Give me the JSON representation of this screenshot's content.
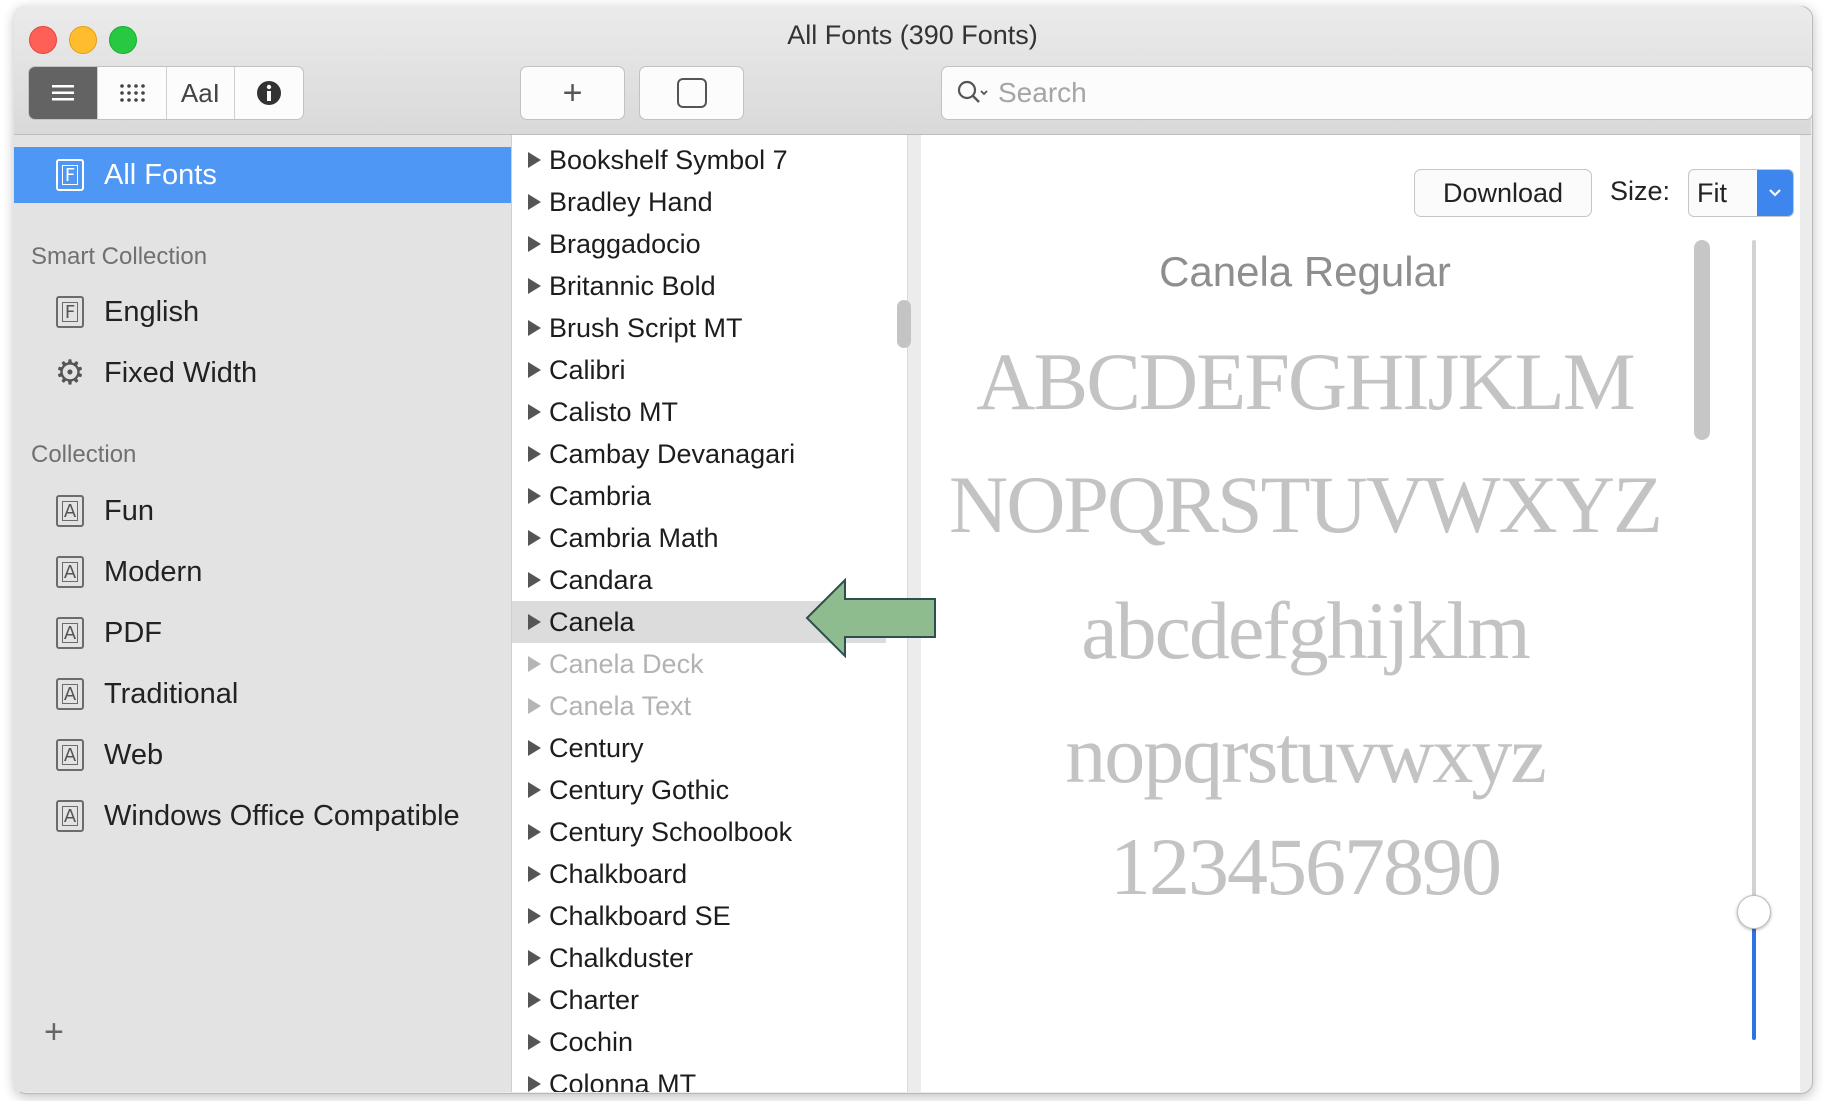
{
  "window": {
    "title": "All Fonts (390 Fonts)"
  },
  "toolbar": {
    "view_modes": [
      {
        "name": "list-view",
        "glyph": "≡"
      },
      {
        "name": "grid-view",
        "glyph": "⠿"
      },
      {
        "name": "sample-view",
        "glyph": "AaI"
      },
      {
        "name": "info-view",
        "glyph": "i"
      }
    ],
    "add_glyph": "+",
    "search_placeholder": "Search"
  },
  "sidebar": {
    "all_fonts": "All Fonts",
    "smart_collection_header": "Smart Collection",
    "smart_items": [
      {
        "label": "English",
        "icon": "F"
      },
      {
        "label": "Fixed Width",
        "icon": "gear"
      }
    ],
    "collection_header": "Collection",
    "collection_items": [
      {
        "label": "Fun",
        "icon": "A"
      },
      {
        "label": "Modern",
        "icon": "A"
      },
      {
        "label": "PDF",
        "icon": "A"
      },
      {
        "label": "Traditional",
        "icon": "A"
      },
      {
        "label": "Web",
        "icon": "A"
      },
      {
        "label": "Windows Office Compatible",
        "icon": "A"
      }
    ],
    "add_glyph": "+"
  },
  "font_list": {
    "items": [
      {
        "name": "Bookshelf Symbol 7",
        "state": "normal"
      },
      {
        "name": "Bradley Hand",
        "state": "normal"
      },
      {
        "name": "Braggadocio",
        "state": "normal"
      },
      {
        "name": "Britannic Bold",
        "state": "normal"
      },
      {
        "name": "Brush Script MT",
        "state": "normal"
      },
      {
        "name": "Calibri",
        "state": "normal"
      },
      {
        "name": "Calisto MT",
        "state": "normal"
      },
      {
        "name": "Cambay Devanagari",
        "state": "normal"
      },
      {
        "name": "Cambria",
        "state": "normal"
      },
      {
        "name": "Cambria Math",
        "state": "normal"
      },
      {
        "name": "Candara",
        "state": "normal"
      },
      {
        "name": "Canela",
        "state": "selected"
      },
      {
        "name": "Canela Deck",
        "state": "dimmed"
      },
      {
        "name": "Canela Text",
        "state": "dimmed"
      },
      {
        "name": "Century",
        "state": "normal"
      },
      {
        "name": "Century Gothic",
        "state": "normal"
      },
      {
        "name": "Century Schoolbook",
        "state": "normal"
      },
      {
        "name": "Chalkboard",
        "state": "normal"
      },
      {
        "name": "Chalkboard SE",
        "state": "normal"
      },
      {
        "name": "Chalkduster",
        "state": "normal"
      },
      {
        "name": "Charter",
        "state": "normal"
      },
      {
        "name": "Cochin",
        "state": "normal"
      },
      {
        "name": "Colonna MT",
        "state": "normal"
      }
    ]
  },
  "preview": {
    "download_label": "Download",
    "size_label": "Size:",
    "size_value": "Fit",
    "font_title": "Canela Regular",
    "sample_lines": [
      "ABCDEFGHIJKLM",
      "NOPQRSTUVWXYZ",
      "abcdefghijklm",
      "nopqrstuvwxyz",
      "1234567890"
    ]
  },
  "colors": {
    "selection_blue": "#4f97f4",
    "callout_arrow_fill": "#8fbc8f",
    "callout_arrow_stroke": "#2f4f4f"
  }
}
